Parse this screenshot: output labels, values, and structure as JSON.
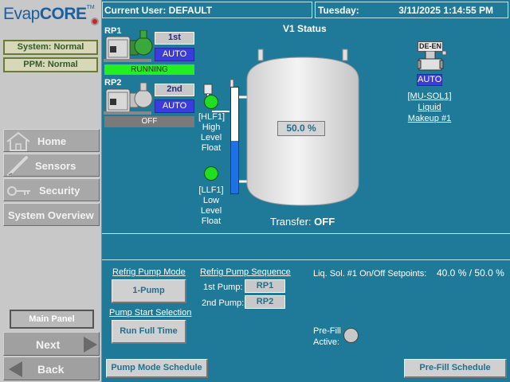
{
  "logo": {
    "name_light": "Evap",
    "name_bold": "CORE",
    "tm": "TM"
  },
  "sidebar": {
    "system_status": "System: Normal",
    "ppm_status": "PPM: Normal",
    "nav": [
      "Home",
      "Sensors",
      "Security",
      "System Overview"
    ],
    "main_panel": "Main Panel",
    "next": "Next",
    "back": "Back"
  },
  "header": {
    "current_user": "Current User: DEFAULT",
    "day": "Tuesday:",
    "datetime": "3/11/2025 1:14:55 PM"
  },
  "status": {
    "title": "V1 Status",
    "rp1": {
      "label": "RP1",
      "order": "1st",
      "mode": "AUTO",
      "state": "RUNNING",
      "state_color": "#22ee22"
    },
    "rp2": {
      "label": "RP2",
      "order": "2nd",
      "mode": "AUTO",
      "state": "OFF",
      "state_color": "#7a7a7a"
    },
    "hlf1": {
      "tag": "[HLF1]",
      "line1": "High",
      "line2": "Level",
      "line3": "Float"
    },
    "llf1": {
      "tag": "[LLF1]",
      "line1": "Low",
      "line2": "Level",
      "line3": "Float"
    },
    "tank_level": "50.0 %",
    "level_fraction": 0.5,
    "transfer_label": "Transfer:",
    "transfer_value": "OFF",
    "valve": {
      "badge": "DE-EN",
      "mode": "AUTO",
      "tag": "[MU-SOL1]",
      "line1": "Liquid",
      "line2": "Makeup #1"
    }
  },
  "controls": {
    "pump_mode_title": "Refrig Pump Mode",
    "pump_mode_value": "1-Pump",
    "start_sel_title": "Pump Start Selection",
    "start_sel_value": "Run Full Time",
    "sequence_title": "Refrig Pump Sequence",
    "first_pump_label": "1st Pump:",
    "first_pump_value": "RP1",
    "second_pump_label": "2nd Pump:",
    "second_pump_value": "RP2",
    "setpoints_label": "Liq. Sol. #1 On/Off Setpoints:",
    "setpoint_on": "40.0 %",
    "setpoint_sep": "/",
    "setpoint_off": "50.0 %",
    "prefill_line1": "Pre-Fill",
    "prefill_line2": "Active:",
    "pump_mode_schedule": "Pump Mode Schedule",
    "prefill_schedule": "Pre-Fill Schedule"
  }
}
